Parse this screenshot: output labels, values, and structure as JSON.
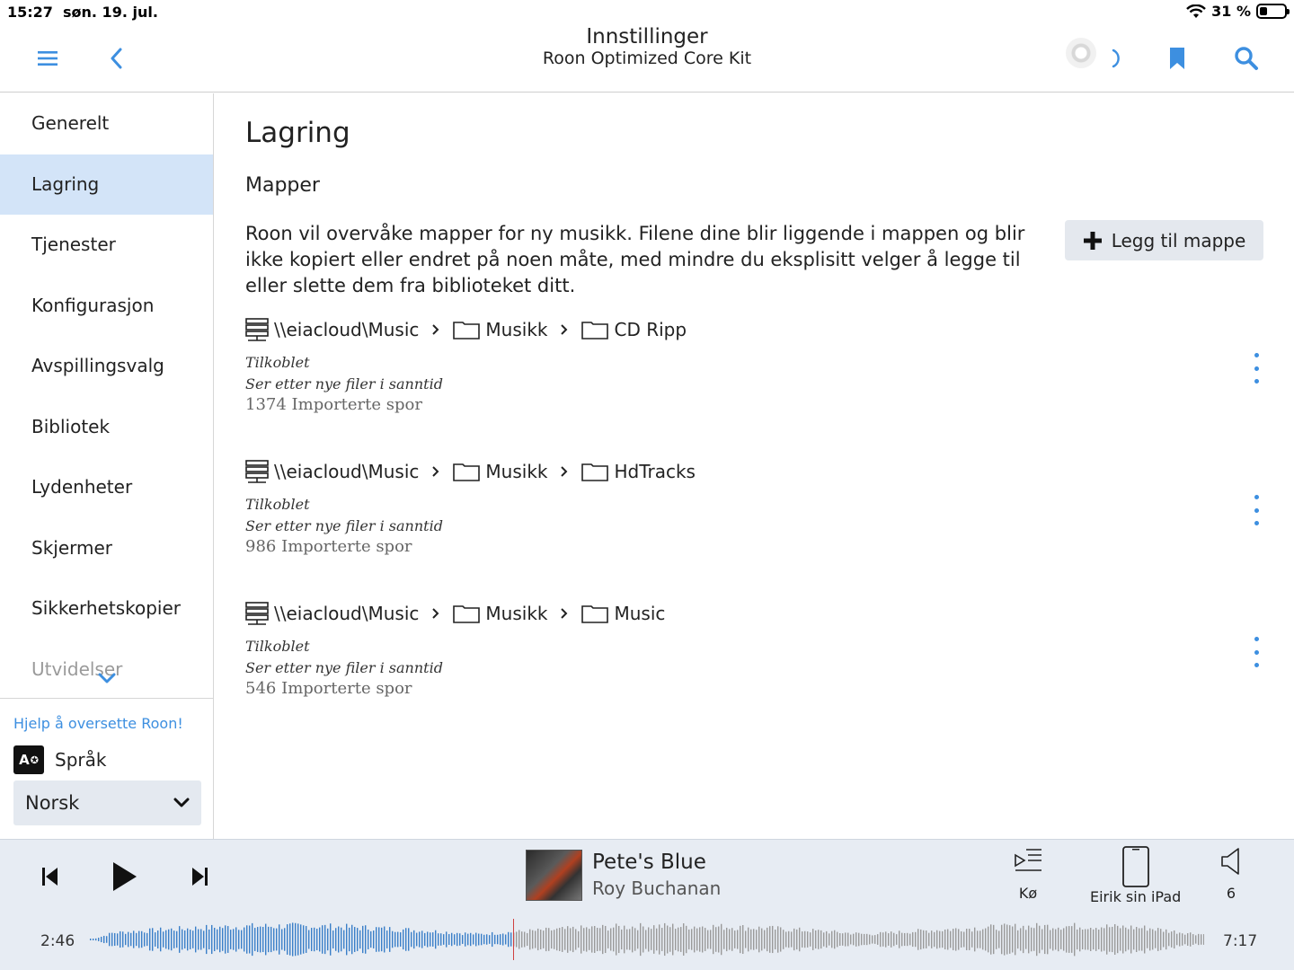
{
  "status_bar": {
    "time": "15:27",
    "date": "søn. 19. jul.",
    "battery": "31 %"
  },
  "header": {
    "title": "Innstillinger",
    "subtitle": "Roon Optimized Core Kit"
  },
  "sidebar": {
    "items": [
      {
        "label": "Generelt"
      },
      {
        "label": "Lagring"
      },
      {
        "label": "Tjenester"
      },
      {
        "label": "Konfigurasjon"
      },
      {
        "label": "Avspillingsvalg"
      },
      {
        "label": "Bibliotek"
      },
      {
        "label": "Lydenheter"
      },
      {
        "label": "Skjermer"
      },
      {
        "label": "Sikkerhetskopier"
      },
      {
        "label": "Utvidelser"
      }
    ],
    "help_link": "Hjelp å oversette Roon!",
    "language_label": "Språk",
    "language_icon_text": "A",
    "language_value": "Norsk"
  },
  "main": {
    "title": "Lagring",
    "section": "Mapper",
    "description": "Roon vil overvåke mapper for ny musikk. Filene dine blir liggende i mappen og blir ikke kopiert eller endret på noen måte, med mindre du eksplisitt velger å legge til eller slette dem fra biblioteket ditt.",
    "add_button": "Legg til mappe",
    "folders": [
      {
        "share": "\\\\eiacloud\\Music",
        "folder1": "Musikk",
        "folder2": "CD Ripp",
        "status": "Tilkoblet",
        "watch": "Ser etter nye filer i sanntid",
        "count": "1374 Importerte spor"
      },
      {
        "share": "\\\\eiacloud\\Music",
        "folder1": "Musikk",
        "folder2": "HdTracks",
        "status": "Tilkoblet",
        "watch": "Ser etter nye filer i sanntid",
        "count": "986 Importerte spor"
      },
      {
        "share": "\\\\eiacloud\\Music",
        "folder1": "Musikk",
        "folder2": "Music",
        "status": "Tilkoblet",
        "watch": "Ser etter nye filer i sanntid",
        "count": "546 Importerte spor"
      }
    ]
  },
  "player": {
    "track": "Pete's Blue",
    "artist": "Roy Buchanan",
    "queue_label": "Kø",
    "zone_label": "Eirik sin iPad",
    "volume": "6",
    "elapsed": "2:46",
    "duration": "7:17",
    "progress_fraction": 0.379
  },
  "colors": {
    "accent": "#3d8fe0",
    "active_nav": "#d3e4f8",
    "player_bg": "#e7ecf3",
    "wave_played": "#3a7fc8",
    "wave_remaining": "#9a9a9a"
  }
}
